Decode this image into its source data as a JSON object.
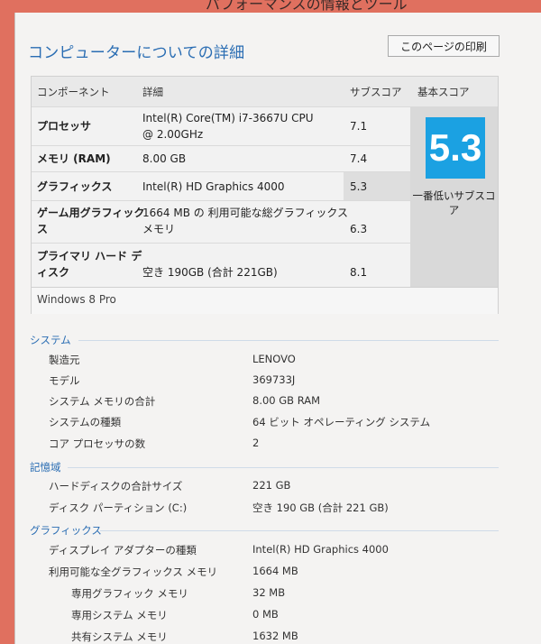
{
  "window": {
    "title": "パフォーマンスの情報とツール"
  },
  "header": {
    "title": "コンピューターについての詳細",
    "print_button": "このページの印刷"
  },
  "score_table": {
    "columns": {
      "component": "コンポーネント",
      "detail": "詳細",
      "subscore": "サブスコア",
      "base": "基本スコア"
    },
    "rows": [
      {
        "component": "プロセッサ",
        "detail_line1": "Intel(R) Core(TM) i7-3667U CPU",
        "detail_line2": "@ 2.00GHz",
        "subscore": "7.1"
      },
      {
        "component": "メモリ (RAM)",
        "detail_line1": "8.00 GB",
        "detail_line2": "",
        "subscore": "7.4"
      },
      {
        "component": "グラフィックス",
        "detail_line1": "Intel(R) HD Graphics 4000",
        "detail_line2": "",
        "subscore": "5.3"
      },
      {
        "component_line1": "ゲーム用グラフィック",
        "component_line2": "ス",
        "detail_line1": "1664 MB の 利用可能な総グラフィックス",
        "detail_line2": "メモリ",
        "subscore": "6.3"
      },
      {
        "component_line1": "プライマリ ハード デ",
        "component_line2": "ィスク",
        "detail_line1": "空き 190GB (合計 221GB)",
        "detail_line2": "",
        "subscore": "8.1"
      }
    ],
    "base_score": "5.3",
    "base_caption": "一番低いサブスコア",
    "os": "Windows 8 Pro",
    "highlight_color": "#1ba1e2"
  },
  "system": {
    "title": "システム",
    "items": [
      {
        "label": "製造元",
        "value": "LENOVO"
      },
      {
        "label": "モデル",
        "value": "369733J"
      },
      {
        "label": "システム メモリの合計",
        "value": "8.00 GB RAM"
      },
      {
        "label": "システムの種類",
        "value": "64 ビット オペレーティング システム"
      },
      {
        "label": "コア プロセッサの数",
        "value": "2"
      }
    ]
  },
  "storage": {
    "title": "記憶域",
    "items": [
      {
        "label": "ハードディスクの合計サイズ",
        "value": "221 GB"
      },
      {
        "label": "ディスク パーティション (C:)",
        "value": "空き 190 GB (合計 221 GB)"
      }
    ]
  },
  "graphics": {
    "title": "グラフィックス",
    "items": [
      {
        "label": "ディスプレイ アダプターの種類",
        "value": "Intel(R) HD Graphics 4000"
      },
      {
        "label": "利用可能な全グラフィックス メモリ",
        "value": "1664 MB"
      },
      {
        "label": "専用グラフィック メモリ",
        "value": "32 MB"
      },
      {
        "label": "専用システム メモリ",
        "value": "0 MB"
      },
      {
        "label": "共有システム メモリ",
        "value": "1632 MB"
      }
    ]
  }
}
